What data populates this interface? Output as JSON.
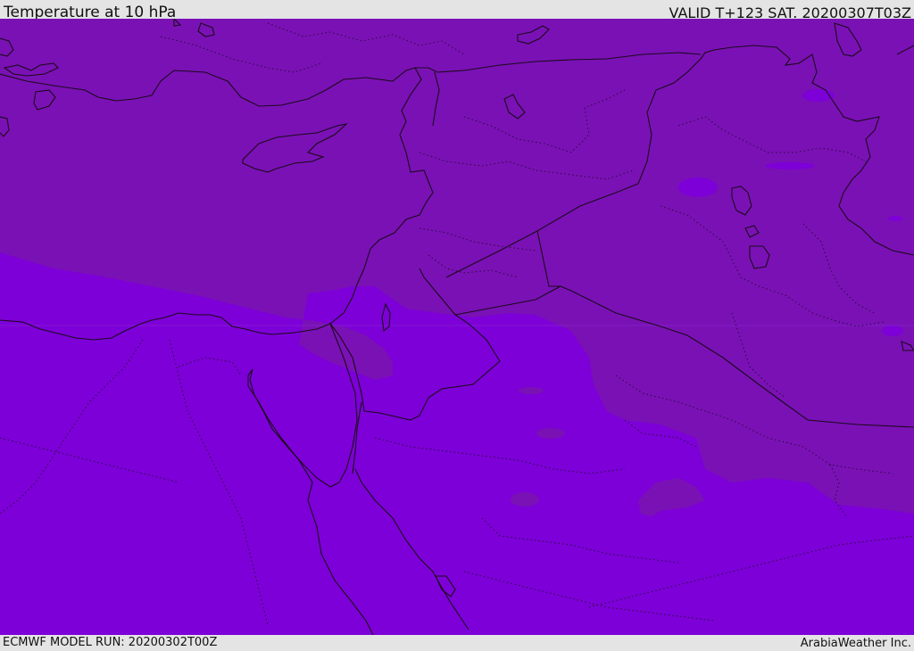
{
  "header": {
    "title": "Temperature at 10 hPa",
    "valid": "VALID T+123 SAT. 20200307T03Z"
  },
  "footer": {
    "model_run": "ECMWF MODEL RUN: 20200302T00Z",
    "credit": "ArabiaWeather Inc."
  },
  "map": {
    "colors": {
      "warm_band": "#7a11b5",
      "cool_band": "#7d00d8",
      "coastline": "#1a0a1a"
    }
  }
}
